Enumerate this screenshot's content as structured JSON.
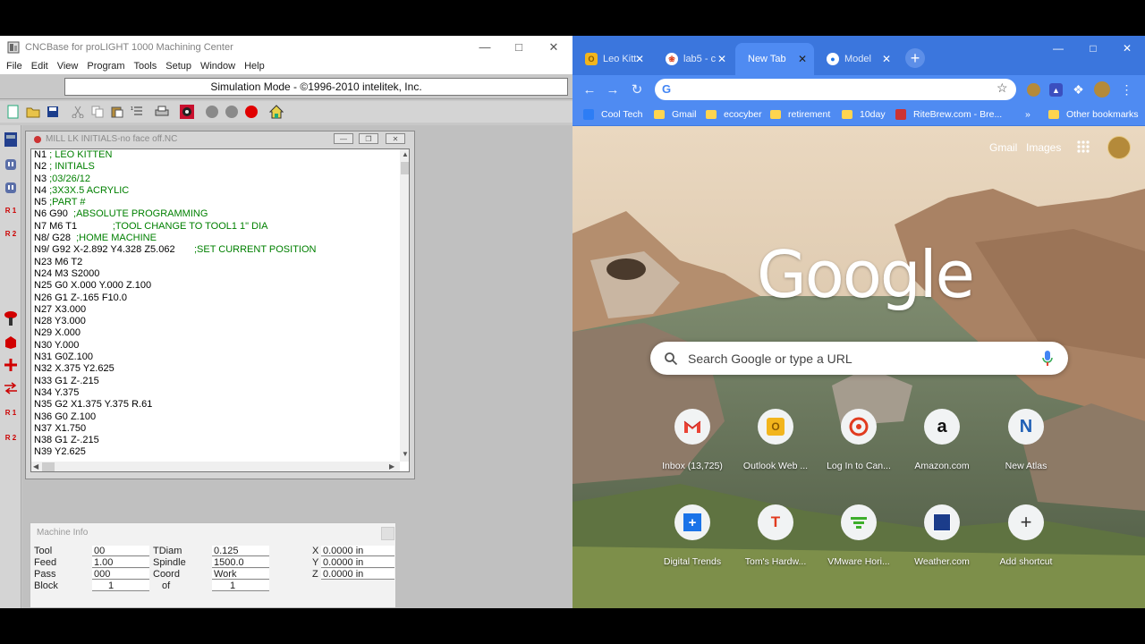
{
  "cnc": {
    "title": "CNCBase for proLIGHT 1000 Machining Center",
    "menu": [
      "File",
      "Edit",
      "View",
      "Program",
      "Tools",
      "Setup",
      "Window",
      "Help"
    ],
    "mode_text": "Simulation Mode - ©1996-2010 intelitek, Inc.",
    "sidebar_labels": [
      "R 1",
      "R 2",
      "R 1",
      "R 2"
    ],
    "nc_window_title": "MILL LK INITIALS-no face off.NC",
    "nc_lines": [
      {
        "code": "N1",
        "text": " ; LEO KITTEN",
        "comment": true
      },
      {
        "code": "N2",
        "text": " ; INITIALS",
        "comment": true
      },
      {
        "code": "N3",
        "text": " ;03/26/12",
        "comment": true
      },
      {
        "code": "N4",
        "text": " ;3X3X.5 ACRYLIC",
        "comment": true
      },
      {
        "code": "N5",
        "text": " ;PART #",
        "comment": true
      },
      {
        "code": "N6 G90",
        "text": "  ;ABSOLUTE PROGRAMMING",
        "comment": true
      },
      {
        "code": "N7 M6 T1",
        "text": "             ;TOOL CHANGE TO TOOL1 1\" DIA",
        "comment": true
      },
      {
        "code": "N8/ G28",
        "text": "  ;HOME MACHINE",
        "comment": true
      },
      {
        "code": "N9/ G92 X-2.892 Y4.328 Z5.062",
        "text": "       ;SET CURRENT POSITION",
        "comment": true
      },
      {
        "code": "N23 M6 T2",
        "text": "",
        "comment": false
      },
      {
        "code": "N24 M3 S2000",
        "text": "",
        "comment": false
      },
      {
        "code": "N25 G0 X.000 Y.000 Z.100",
        "text": "",
        "comment": false
      },
      {
        "code": "N26 G1 Z-.165 F10.0",
        "text": "",
        "comment": false
      },
      {
        "code": "N27 X3.000",
        "text": "",
        "comment": false
      },
      {
        "code": "N28 Y3.000",
        "text": "",
        "comment": false
      },
      {
        "code": "N29 X.000",
        "text": "",
        "comment": false
      },
      {
        "code": "N30 Y.000",
        "text": "",
        "comment": false
      },
      {
        "code": "N31 G0Z.100",
        "text": "",
        "comment": false
      },
      {
        "code": "N32 X.375 Y2.625",
        "text": "",
        "comment": false
      },
      {
        "code": "N33 G1 Z-.215",
        "text": "",
        "comment": false
      },
      {
        "code": "N34 Y.375",
        "text": "",
        "comment": false
      },
      {
        "code": "N35 G2 X1.375 Y.375 R.61",
        "text": "",
        "comment": false
      },
      {
        "code": "N36 G0 Z.100",
        "text": "",
        "comment": false
      },
      {
        "code": "N37 X1.750",
        "text": "",
        "comment": false
      },
      {
        "code": "N38 G1 Z-.215",
        "text": "",
        "comment": false
      },
      {
        "code": "N39 Y2.625",
        "text": "",
        "comment": false
      }
    ],
    "machine_info": {
      "title": "Machine Info",
      "tool_label": "Tool",
      "tool_value": "00",
      "feed_label": "Feed",
      "feed_value": "1.00",
      "pass_label": "Pass",
      "pass_value": "000",
      "block_label": "Block",
      "block_value": "1",
      "tdiam_label": "TDiam",
      "tdiam_value": "0.125",
      "spindle_label": "Spindle",
      "spindle_value": "1500.0",
      "coord_label": "Coord",
      "coord_value": "Work",
      "of_label": "of",
      "of_value": "1",
      "x_label": "X",
      "x_value": "0.0000 in",
      "y_label": "Y",
      "y_value": "0.0000 in",
      "z_label": "Z",
      "z_value": "0.0000 in"
    }
  },
  "chrome": {
    "tabs": [
      {
        "label": "Leo Kitt",
        "icon": "outlook-icon",
        "active": false
      },
      {
        "label": "lab5 - c",
        "icon": "canvas-icon",
        "active": false
      },
      {
        "label": "New Tab",
        "icon": "",
        "active": true
      },
      {
        "label": "Model",
        "icon": "globe-icon",
        "active": false
      }
    ],
    "omnibox_value": "",
    "bookmarks": [
      "Cool Tech",
      "Gmail",
      "ecocyber",
      "retirement",
      "10day",
      "RiteBrew.com - Bre...",
      "»",
      "Other bookmarks"
    ],
    "ntp_links": [
      "Gmail",
      "Images"
    ],
    "logo": "Google",
    "search_placeholder": "Search Google or type a URL",
    "shortcuts": [
      {
        "label": "Inbox (13,725)",
        "icon": "gmail-icon"
      },
      {
        "label": "Outlook Web ...",
        "icon": "outlook-icon"
      },
      {
        "label": "Log In to Can...",
        "icon": "canvas-icon"
      },
      {
        "label": "Amazon.com",
        "icon": "amazon-icon"
      },
      {
        "label": "New Atlas",
        "icon": "new-atlas-icon"
      },
      {
        "label": "Digital Trends",
        "icon": "digital-trends-icon"
      },
      {
        "label": "Tom's Hardw...",
        "icon": "toms-hardware-icon"
      },
      {
        "label": "VMware Hori...",
        "icon": "vmware-icon"
      },
      {
        "label": "Weather.com",
        "icon": "weather-icon"
      },
      {
        "label": "Add shortcut",
        "icon": "plus-icon"
      }
    ],
    "colors": {
      "tabbar": "#3b76dd",
      "toolbar": "#4f8bf2"
    }
  }
}
